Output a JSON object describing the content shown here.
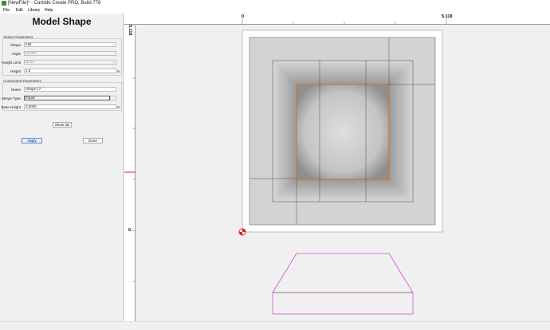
{
  "window": {
    "title": "[NewFile]* - Carbide Create PRO, Build 778"
  },
  "menu": {
    "file": "File",
    "edit": "Edit",
    "library": "Library",
    "help": "Help"
  },
  "panel": {
    "title": "Model Shape",
    "shape_params": {
      "label": "Shape Parameters",
      "shape_label": "Shape",
      "shape_value": "Flat",
      "angle_label": "Angle",
      "angle_value": "45.000",
      "height_limit_label": "Height Limit",
      "height_limit_value": "None",
      "height_label": "Height",
      "height_value": "1.5",
      "height_unit": "in"
    },
    "component_params": {
      "label": "Component Parameters",
      "name_label": "Name",
      "name_value": "Shape 17",
      "merge_label": "Merge Type",
      "merge_value": "Equal",
      "base_height_label": "Base Height",
      "base_height_value": "0.0000",
      "base_height_unit": "in"
    },
    "show3d_label": "Show 3D",
    "apply_label": "Apply",
    "done_label": "Done"
  },
  "rulers": {
    "top_zero": "0",
    "top_max": "5.118",
    "left_max": "5.118",
    "left_zero": "0"
  },
  "colors": {
    "selection": "#c87a3a",
    "profile": "#d14fd1",
    "origin_marker": "#e02020",
    "ruler_marker": "#e02020"
  }
}
